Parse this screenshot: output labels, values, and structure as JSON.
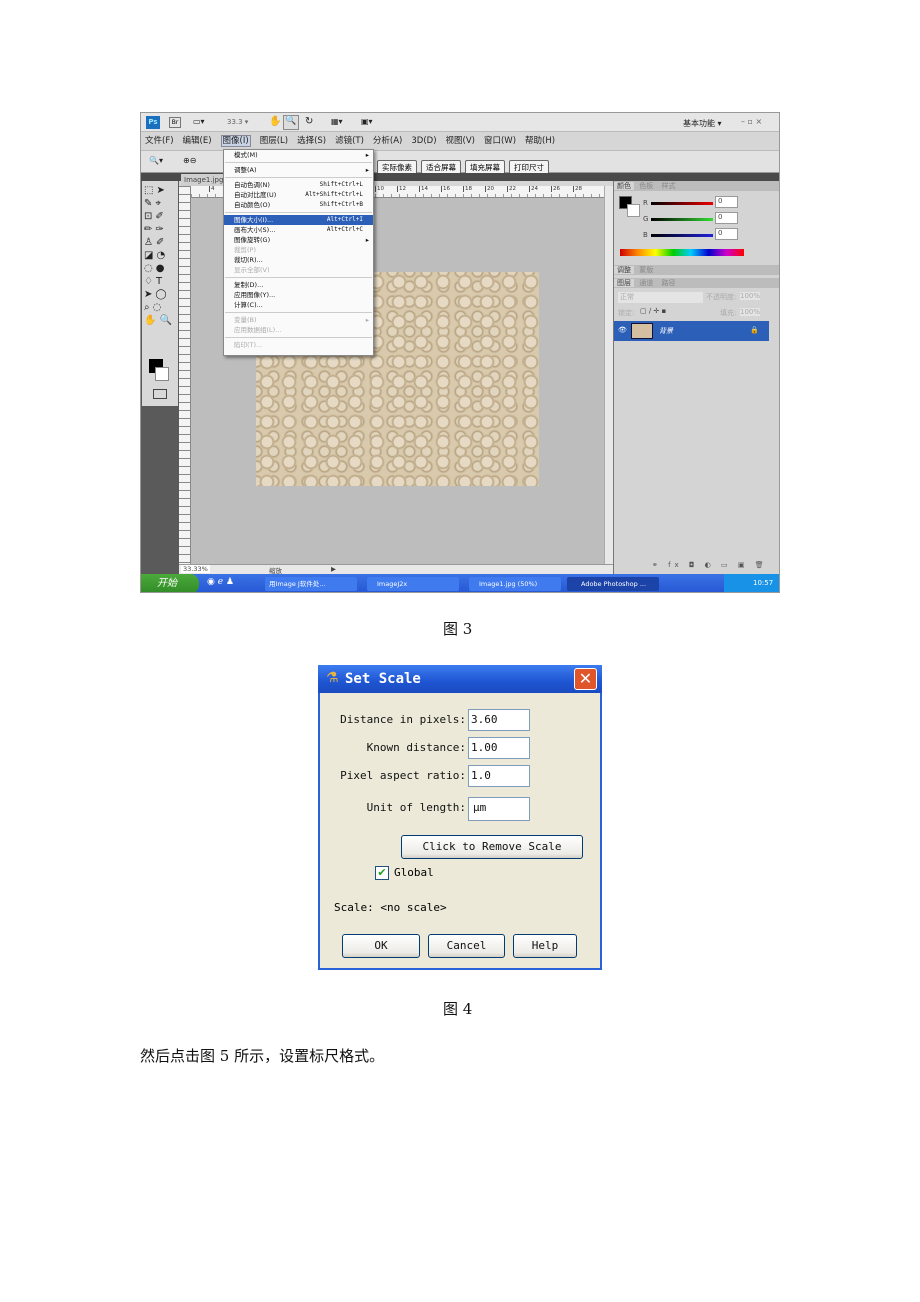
{
  "fig3": {
    "caption": "图 3",
    "titlebar": {
      "zoom": "33.3 ▾",
      "workspace": "基本功能 ▾",
      "window_controls": "– ▫ ×",
      "ps_logo": "Ps",
      "br_logo": "Br"
    },
    "menubar": [
      "文件(F)",
      "编辑(E)",
      "图像(I)",
      "图层(L)",
      "选择(S)",
      "滤镜(T)",
      "分析(A)",
      "3D(D)",
      "视图(V)",
      "窗口(W)",
      "帮助(H)"
    ],
    "options": {
      "buttons": [
        "实际像素",
        "适合屏幕",
        "填充屏幕",
        "打印尺寸"
      ]
    },
    "doc_tab": "Image1.jpg",
    "ruler_ticks": [
      "4",
      "10",
      "12",
      "14",
      "16",
      "18",
      "20",
      "22",
      "24",
      "26",
      "28"
    ],
    "image_menu": [
      {
        "label": "模式(M)",
        "submenu": true
      },
      {
        "sep": true
      },
      {
        "label": "调整(A)",
        "submenu": true
      },
      {
        "sep": true
      },
      {
        "label": "自动色调(N)",
        "shortcut": "Shift+Ctrl+L"
      },
      {
        "label": "自动对比度(U)",
        "shortcut": "Alt+Shift+Ctrl+L"
      },
      {
        "label": "自动颜色(O)",
        "shortcut": "Shift+Ctrl+B"
      },
      {
        "sep": true
      },
      {
        "label": "图像大小(I)...",
        "shortcut": "Alt+Ctrl+I",
        "highlighted": true
      },
      {
        "label": "画布大小(S)...",
        "shortcut": "Alt+Ctrl+C"
      },
      {
        "label": "图像旋转(G)",
        "submenu": true
      },
      {
        "label": "裁剪(P)",
        "disabled": true
      },
      {
        "label": "裁切(R)..."
      },
      {
        "label": "显示全部(V)",
        "disabled": true
      },
      {
        "sep": true
      },
      {
        "label": "复制(D)..."
      },
      {
        "label": "应用图像(Y)..."
      },
      {
        "label": "计算(C)..."
      },
      {
        "sep": true
      },
      {
        "label": "变量(B)",
        "disabled": true,
        "submenu": true
      },
      {
        "label": "应用数据组(L)...",
        "disabled": true
      },
      {
        "sep": true
      },
      {
        "label": "陷印(T)...",
        "disabled": true
      }
    ],
    "color_panel": {
      "tabs": [
        "颜色",
        "色板",
        "样式"
      ],
      "r": "0",
      "g": "0",
      "b": "0",
      "r_label": "R",
      "g_label": "G",
      "b_label": "B"
    },
    "adjust_panel": {
      "tabs": [
        "调整",
        "蒙版"
      ]
    },
    "layers_panel": {
      "tabs": [
        "图层",
        "通道",
        "路径"
      ],
      "blend_mode": "正常",
      "opacity_label": "不透明度:",
      "opacity": "100%",
      "lock_label": "锁定:",
      "fill_label": "填充:",
      "fill": "100%",
      "layer_name": "背景"
    },
    "status": {
      "zoom": "33.33%",
      "info": "缩放"
    },
    "taskbar": {
      "start": "开始",
      "items": [
        "用Image J软件处...",
        "ImageJ2x",
        "Image1.jpg (50%)",
        "Adobe Photoshop ..."
      ],
      "clock": "10:57"
    },
    "colors": {
      "highlight": "#2c5fb8",
      "taskbar": "#2a5ad6",
      "canvas": "#bdbdbd"
    }
  },
  "fig4": {
    "caption": "图 4",
    "dialog": {
      "title": "Set Scale",
      "fields": [
        {
          "label": "Distance in pixels:",
          "value": "3.60"
        },
        {
          "label": "Known distance:",
          "value": "1.00"
        },
        {
          "label": "Pixel aspect ratio:",
          "value": "1.0"
        },
        {
          "label": "Unit of length:",
          "value": "μm"
        }
      ],
      "remove_button": "Click to Remove Scale",
      "global_label": "Global",
      "global_checked": true,
      "scale_text": "Scale: <no scale>",
      "buttons": [
        "OK",
        "Cancel",
        "Help"
      ],
      "colors": {
        "title": "#2158d6",
        "body": "#ece9d8",
        "close": "#e0552a"
      }
    }
  },
  "paragraph": "然后点击图 5 所示，设置标尺格式。"
}
